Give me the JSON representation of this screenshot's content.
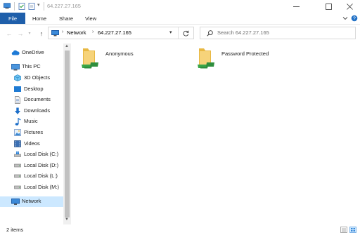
{
  "window": {
    "title": "64.227.27.165",
    "controls": [
      "minimize-icon",
      "maximize-icon",
      "close-icon"
    ]
  },
  "ribbon": {
    "file_tab": "File",
    "tabs": [
      "Home",
      "Share",
      "View"
    ]
  },
  "address": {
    "segments": [
      "Network",
      "64.227.27.165"
    ],
    "search_placeholder": "Search 64.227.27.165"
  },
  "nav_pane": {
    "items": [
      {
        "label": "OneDrive",
        "icon": "onedrive-cloud-icon"
      },
      {
        "label": "This PC",
        "icon": "this-pc-icon"
      },
      {
        "label": "3D Objects",
        "icon": "3d-objects-icon"
      },
      {
        "label": "Desktop",
        "icon": "desktop-icon"
      },
      {
        "label": "Documents",
        "icon": "documents-icon"
      },
      {
        "label": "Downloads",
        "icon": "downloads-icon"
      },
      {
        "label": "Music",
        "icon": "music-icon"
      },
      {
        "label": "Pictures",
        "icon": "pictures-icon"
      },
      {
        "label": "Videos",
        "icon": "videos-icon"
      },
      {
        "label": "Local Disk (C:)",
        "icon": "drive-icon"
      },
      {
        "label": "Local Disk (D:)",
        "icon": "drive-icon"
      },
      {
        "label": "Local Disk (L:)",
        "icon": "drive-icon"
      },
      {
        "label": "Local Disk (M:)",
        "icon": "drive-icon"
      },
      {
        "label": "Network",
        "icon": "network-icon",
        "selected": true
      }
    ]
  },
  "content": {
    "items": [
      {
        "label": "Anonymous",
        "icon": "shared-folder-icon"
      },
      {
        "label": "Password Protected",
        "icon": "shared-folder-icon"
      }
    ]
  },
  "status": {
    "item_count": "2 items"
  },
  "colors": {
    "file_tab": "#1f5faa",
    "selection": "#cce8ff",
    "folder": "#f3c94f",
    "share_badge": "#3aa64a"
  }
}
